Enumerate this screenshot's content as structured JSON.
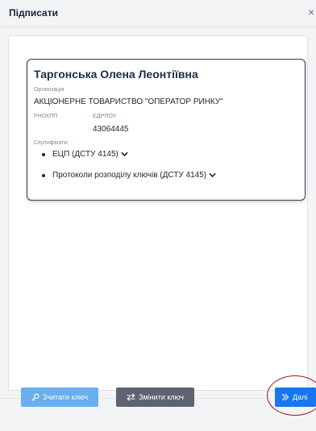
{
  "dialog": {
    "title": "Підписати",
    "close_symbol": "×"
  },
  "signer": {
    "name": "Таргонська Олена Леонтіївна",
    "organization_label": "Організація",
    "organization": "АКЦІОНЕРНЕ ТОВАРИСТВО \"ОПЕРАТОР РИНКУ\"",
    "rnokpp_label": "РНОКПП",
    "edrpou_label": "ЄДРПОУ",
    "edrpou": "43064445",
    "certificates_label": "Сертифікати:",
    "certificates": [
      "ЕЦП (ДСТУ 4145)",
      "Протоколи розподілу ключів (ДСТУ 4145)"
    ]
  },
  "footer": {
    "read_key_label": "Зчитати ключ",
    "change_key_label": "Змінити ключ",
    "next_label": "Далі"
  },
  "colors": {
    "primary": "#1677ee",
    "primary_light": "#6aaef0",
    "secondary": "#5d6470",
    "card_border": "#2b3a55",
    "highlight": "#a11515"
  },
  "icons": {
    "read_key": "key-icon",
    "change_key": "swap-arrows-icon",
    "next": "double-chevron-right-icon",
    "expand": "chevron-down-icon",
    "close": "close-icon"
  }
}
